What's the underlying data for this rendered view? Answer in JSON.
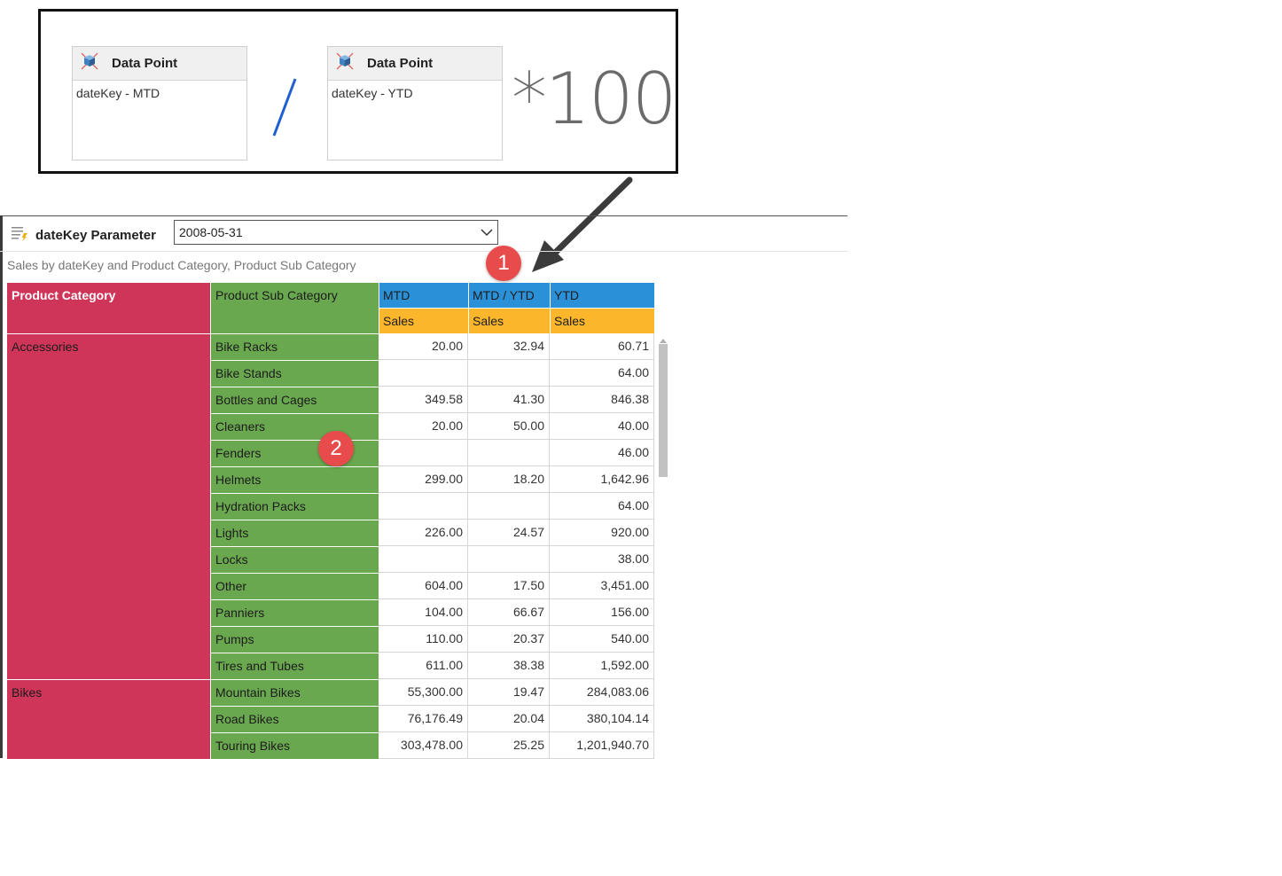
{
  "formula": {
    "left_card": {
      "title": "Data Point",
      "field": "dateKey - MTD",
      "icon": "cube-icon"
    },
    "operator": "/",
    "right_card": {
      "title": "Data Point",
      "field": "dateKey - YTD",
      "icon": "cube-icon"
    },
    "multiplier": "*100"
  },
  "parameter": {
    "label": "dateKey Parameter",
    "value": "2008-05-31",
    "icon": "parameter-list-icon"
  },
  "report": {
    "subtitle": "Sales by dateKey and Product Category, Product Sub Category",
    "headers": {
      "category": "Product Category",
      "sub_category": "Product Sub Category",
      "columns": [
        {
          "group": "MTD",
          "measure": "Sales"
        },
        {
          "group": "MTD / YTD",
          "measure": "Sales"
        },
        {
          "group": "YTD",
          "measure": "Sales"
        }
      ]
    },
    "groups": [
      {
        "category": "Accessories",
        "rows": [
          {
            "sub": "Bike Racks",
            "mtd": "20.00",
            "ratio": "32.94",
            "ytd": "60.71"
          },
          {
            "sub": "Bike Stands",
            "mtd": "",
            "ratio": "",
            "ytd": "64.00"
          },
          {
            "sub": "Bottles and Cages",
            "mtd": "349.58",
            "ratio": "41.30",
            "ytd": "846.38"
          },
          {
            "sub": "Cleaners",
            "mtd": "20.00",
            "ratio": "50.00",
            "ytd": "40.00"
          },
          {
            "sub": "Fenders",
            "mtd": "",
            "ratio": "",
            "ytd": "46.00"
          },
          {
            "sub": "Helmets",
            "mtd": "299.00",
            "ratio": "18.20",
            "ytd": "1,642.96"
          },
          {
            "sub": "Hydration Packs",
            "mtd": "",
            "ratio": "",
            "ytd": "64.00"
          },
          {
            "sub": "Lights",
            "mtd": "226.00",
            "ratio": "24.57",
            "ytd": "920.00"
          },
          {
            "sub": "Locks",
            "mtd": "",
            "ratio": "",
            "ytd": "38.00"
          },
          {
            "sub": "Other",
            "mtd": "604.00",
            "ratio": "17.50",
            "ytd": "3,451.00"
          },
          {
            "sub": "Panniers",
            "mtd": "104.00",
            "ratio": "66.67",
            "ytd": "156.00"
          },
          {
            "sub": "Pumps",
            "mtd": "110.00",
            "ratio": "20.37",
            "ytd": "540.00"
          },
          {
            "sub": "Tires and Tubes",
            "mtd": "611.00",
            "ratio": "38.38",
            "ytd": "1,592.00"
          }
        ]
      },
      {
        "category": "Bikes",
        "rows": [
          {
            "sub": "Mountain Bikes",
            "mtd": "55,300.00",
            "ratio": "19.47",
            "ytd": "284,083.06"
          },
          {
            "sub": "Road Bikes",
            "mtd": "76,176.49",
            "ratio": "20.04",
            "ytd": "380,104.14"
          },
          {
            "sub": "Touring Bikes",
            "mtd": "303,478.00",
            "ratio": "25.25",
            "ytd": "1,201,940.70"
          }
        ]
      }
    ]
  },
  "badges": [
    "1",
    "2"
  ],
  "colors": {
    "category": "#cf3459",
    "sub_category": "#6aa84f",
    "measure_group": "#2a91d8",
    "measure": "#fbb62b",
    "badge": "#e84b4b",
    "operator": "#1f5fd1"
  }
}
